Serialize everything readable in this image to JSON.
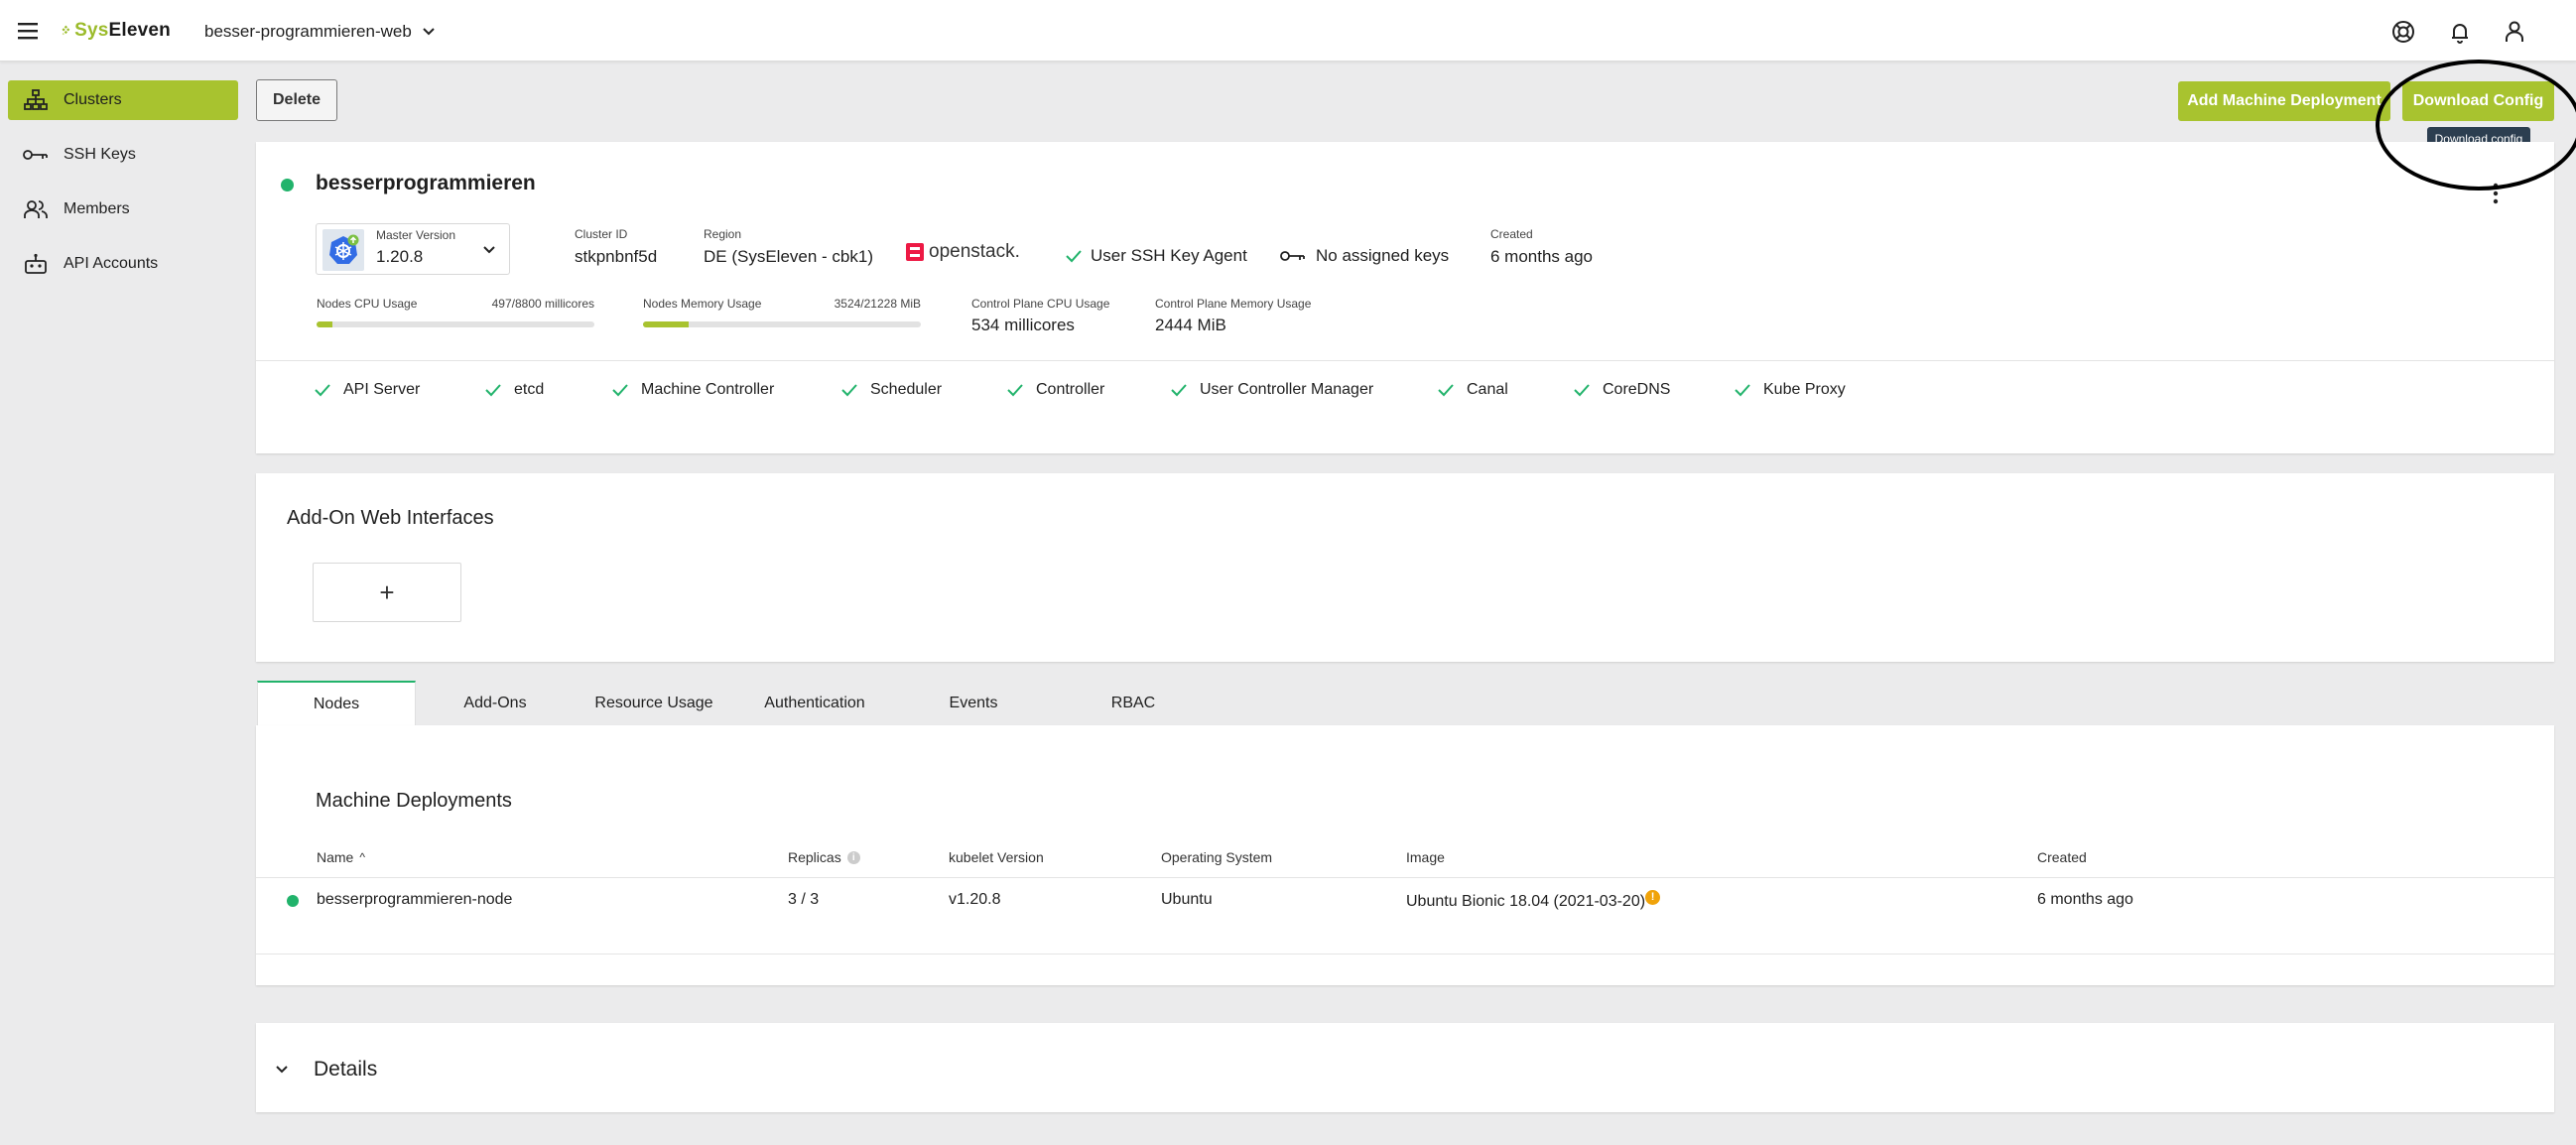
{
  "header": {
    "logo_text_prefix": "Sys",
    "logo_text_suffix": "Eleven",
    "project": "besser-programmieren-web"
  },
  "sidebar": {
    "items": [
      {
        "label": "Clusters",
        "icon": "sitemap-icon",
        "active": true
      },
      {
        "label": "SSH Keys",
        "icon": "key-icon"
      },
      {
        "label": "Members",
        "icon": "members-icon"
      },
      {
        "label": "API Accounts",
        "icon": "robot-icon"
      }
    ]
  },
  "toolbar": {
    "delete_label": "Delete",
    "add_md_label": "Add Machine Deployment",
    "download_label": "Download Config",
    "tooltip": "Download config"
  },
  "cluster": {
    "name": "besserprogrammieren",
    "master_version_label": "Master Version",
    "master_version": "1.20.8",
    "cluster_id_label": "Cluster ID",
    "cluster_id": "stkpnbnf5d",
    "region_label": "Region",
    "region": "DE (SysEleven - cbk1)",
    "provider": "openstack.",
    "ssh_agent": "User SSH Key Agent",
    "keys": "No assigned keys",
    "created_label": "Created",
    "created": "6 months ago",
    "cpu_label": "Nodes CPU Usage",
    "cpu_value": "497/8800 millicores",
    "cpu_fraction": 0.056,
    "mem_label": "Nodes Memory Usage",
    "mem_value": "3524/21228 MiB",
    "mem_fraction": 0.166,
    "cp_cpu_label": "Control Plane CPU Usage",
    "cp_cpu": "534 millicores",
    "cp_mem_label": "Control Plane Memory Usage",
    "cp_mem": "2444 MiB",
    "health": [
      "API Server",
      "etcd",
      "Machine Controller",
      "Scheduler",
      "Controller",
      "User Controller Manager",
      "Canal",
      "CoreDNS",
      "Kube Proxy"
    ]
  },
  "addons": {
    "title": "Add-On Web Interfaces",
    "add_symbol": "+"
  },
  "tabs": [
    "Nodes",
    "Add-Ons",
    "Resource Usage",
    "Authentication",
    "Events",
    "RBAC"
  ],
  "machine_deployments": {
    "title": "Machine Deployments",
    "columns": [
      "Name",
      "Replicas",
      "kubelet Version",
      "Operating System",
      "Image",
      "Created"
    ],
    "sort_indicator": "^",
    "info_symbol": "i",
    "warn_symbol": "!",
    "rows": [
      {
        "name": "besserprogrammieren-node",
        "replicas": "3 / 3",
        "kubelet": "v1.20.8",
        "os": "Ubuntu",
        "image": "Ubuntu Bionic 18.04 (2021-03-20)",
        "created": "6 months ago"
      }
    ]
  },
  "details": {
    "title": "Details"
  },
  "colors": {
    "accent": "#a8c32f",
    "status_ok": "#21b36b",
    "warning": "#f0a30a"
  }
}
